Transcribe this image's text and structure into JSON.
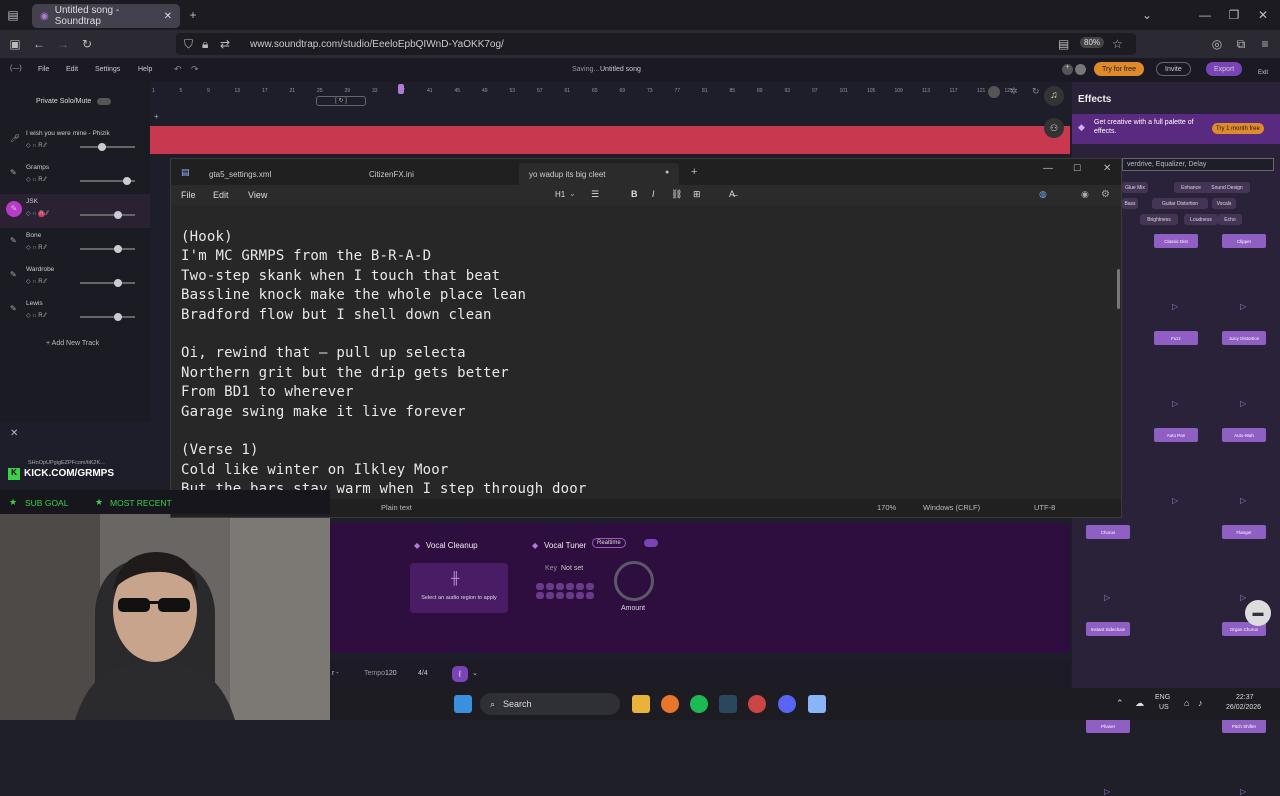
{
  "browser": {
    "tab_title": "Untitled song - Soundtrap",
    "url": "www.soundtrap.com/studio/EeeloEpbQIWnD-YaOKK7og/",
    "zoom": "80%"
  },
  "soundtrap": {
    "menu": [
      "File",
      "Edit",
      "Settings",
      "Help"
    ],
    "status": "Saving...",
    "song_title": "Untitled song",
    "try_free": "Try for free",
    "invite": "Invite",
    "export": "Export",
    "exit": "Exit",
    "private_solo": "Private Solo/Mute",
    "ruler": [
      "1",
      "5",
      "9",
      "13",
      "17",
      "21",
      "25",
      "29",
      "33",
      "37",
      "41",
      "45",
      "49",
      "53",
      "57",
      "61",
      "65",
      "69",
      "73",
      "77",
      "81",
      "85",
      "89",
      "93",
      "97",
      "101",
      "105",
      "109",
      "113",
      "117",
      "121",
      "125"
    ],
    "tracks": [
      {
        "name": "I wish you were mine - Phizik",
        "volume": 0.4
      },
      {
        "name": "Gramps",
        "volume": 0.85
      },
      {
        "name": "JSK",
        "volume": 0.7
      },
      {
        "name": "Bone",
        "volume": 0.7
      },
      {
        "name": "Wardrobe",
        "volume": 0.7
      },
      {
        "name": "Lewis",
        "volume": 0.7
      }
    ],
    "add_track": "+ Add New Track",
    "effects": {
      "title": "Effects",
      "promo": "Get creative with a full palette of effects.",
      "trial": "Try 1 month free",
      "search_placeholder": "verdrive, Equalizer, Delay",
      "chips": [
        "Glue Mix",
        "Enhance",
        "Sound Design",
        "Bass",
        "Guitar Distortion",
        "Vocals",
        "Brightness",
        "Loudness",
        "Echo"
      ],
      "cards": [
        "Classic Dist",
        "Clipper",
        "Fuzz",
        "Juicy Distortion",
        "Auto Pan",
        "Auto-Wah",
        "Chorus",
        "Flanger",
        "Instant Sidechain",
        "Organ Chorus",
        "Phaser",
        "Pitch Shifter"
      ]
    },
    "vocal_cleanup": "Vocal Cleanup",
    "vocal_cleanup_hint": "Select an audio region to apply",
    "vocal_tuner": "Vocal Tuner",
    "realtime": "Realtime",
    "key": "Key",
    "key_value": "Not set",
    "amount": "Amount",
    "tempo_label": "Tempo",
    "tempo": "120",
    "time_sig": "4/4",
    "kick_url": "KICK.COM/GRMPS",
    "sub_goal": "SUB GOAL",
    "most_recent": "MOST RECENT",
    "kick_small": "SHnOpUPgigEZPFcom/tiK2K..."
  },
  "notepad": {
    "tabs": [
      "gta5_settings.xml",
      "CitizenFX.ini",
      "yo wadup its big cleet"
    ],
    "menu": [
      "File",
      "Edit",
      "View"
    ],
    "heading": "H1",
    "lines": [
      "(Hook)",
      "I'm MC GRMPS from the B-R-A-D",
      "Two-step skank when I touch that beat",
      "Bassline knock make the whole place lean",
      "Bradford flow but I shell down clean",
      "",
      "Oi, rewind that — pull up selecta",
      "Northern grit but the drip gets better",
      "From BD1 to wherever",
      "Garage swing make it live forever",
      "",
      "(Verse 1)",
      "Cold like winter on Ilkley Moor",
      "But the bars stay warm when I step through door"
    ],
    "status": {
      "format": "Plain text",
      "zoom": "170%",
      "line_ending": "Windows (CRLF)",
      "encoding": "UTF-8"
    }
  },
  "taskbar": {
    "search": "Search",
    "lang": "ENG",
    "region": "US",
    "time": "22:37",
    "date": "26/02/2026"
  }
}
